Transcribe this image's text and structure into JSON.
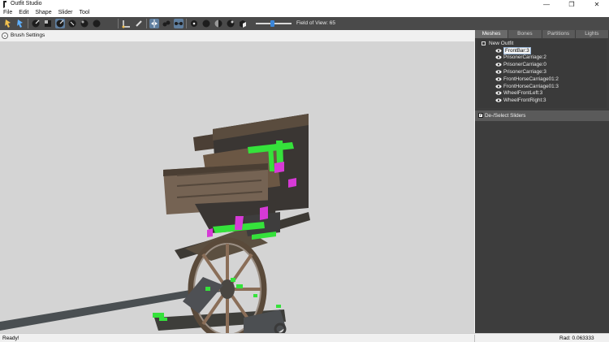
{
  "window": {
    "title": "Outfit Studio",
    "minimize_glyph": "—",
    "restore_glyph": "❐",
    "close_glyph": "✕"
  },
  "menu": [
    "File",
    "Edit",
    "Shape",
    "Slider",
    "Tool"
  ],
  "toolbar": {
    "tools": [
      {
        "name": "select-tool-icon",
        "active": false
      },
      {
        "name": "transform-tool-icon",
        "active": false
      },
      {
        "name": "mask-brush-icon",
        "active": false
      },
      {
        "name": "inflate-brush-icon",
        "active": false
      },
      {
        "name": "deflate-brush-icon",
        "active": true
      },
      {
        "name": "move-brush-icon",
        "active": false
      },
      {
        "name": "smooth-brush-icon",
        "active": false
      },
      {
        "name": "pivot-tool-icon",
        "active": false
      },
      {
        "name": "vertex-edit-icon",
        "active": false
      },
      {
        "name": "xmirror-icon",
        "active": true
      },
      {
        "name": "connected-only-icon",
        "active": false
      },
      {
        "name": "global-brush-icon",
        "active": false
      },
      {
        "name": "show-wireframe-icon",
        "active": false
      },
      {
        "name": "toggle-lighting-icon",
        "active": false
      },
      {
        "name": "toggle-texture-icon",
        "active": false
      },
      {
        "name": "toggle-color-icon",
        "active": false
      },
      {
        "name": "front-view-icon",
        "active": false
      }
    ],
    "field_of_view_label": "Field of View: 65",
    "field_of_view_level": 0.45
  },
  "viewport": {
    "brush_settings_label": "Brush Settings",
    "brush_toggle_glyph": "⌄",
    "background_color": "#d4d4d4"
  },
  "panel": {
    "tabs": [
      {
        "label": "Meshes",
        "active": true
      },
      {
        "label": "Bones",
        "active": false
      },
      {
        "label": "Partitions",
        "active": false
      },
      {
        "label": "Lights",
        "active": false
      }
    ],
    "tree_root": "New Outfit",
    "meshes": [
      {
        "label": "FrontBar:3",
        "selected": true
      },
      {
        "label": "PrisonerCarriage:2",
        "selected": false
      },
      {
        "label": "PrisonerCarriage:0",
        "selected": false
      },
      {
        "label": "PrisonerCarriage:3",
        "selected": false
      },
      {
        "label": "FrontHorseCarriage01:2",
        "selected": false
      },
      {
        "label": "FrontHorseCarriage01:3",
        "selected": false
      },
      {
        "label": "WheelFrontLeft:3",
        "selected": false
      },
      {
        "label": "WheelFrontRight:3",
        "selected": false
      }
    ],
    "sliders_label": "De-/Select Sliders",
    "sliders_checked_glyph": "✓"
  },
  "status": {
    "left": "Ready!",
    "right": "Rad: 0.063333"
  },
  "colors": {
    "accent": "#3b86d8",
    "mask_green": "#35e23b",
    "weight_magenta": "#d63ad6",
    "panel_bg": "#3d3d3d",
    "toolbar_bg": "#4a4a4a"
  }
}
